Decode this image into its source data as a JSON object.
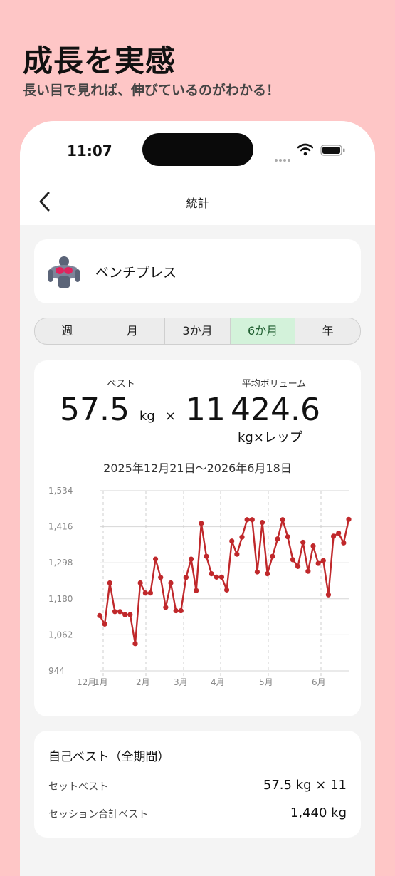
{
  "promo": {
    "headline": "成長を実感",
    "subline": "長い目で見れば、伸びているのがわかる！"
  },
  "status_bar": {
    "time": "11:07",
    "icons": [
      "signal-dots-icon",
      "wifi-icon",
      "battery-icon"
    ]
  },
  "nav": {
    "back_icon": "chevron-left-icon",
    "title": "統計"
  },
  "exercise": {
    "icon": "muscle-torso-icon",
    "name": "ベンチプレス"
  },
  "periods": {
    "items": [
      "週",
      "月",
      "3か月",
      "6か月",
      "年"
    ],
    "selected": "6か月"
  },
  "stats": {
    "best_label": "ベスト",
    "best_weight": "57.5",
    "best_unit": "kg",
    "best_times": "×",
    "best_reps": "11",
    "avg_label": "平均ボリューム",
    "avg_value": "424.6",
    "avg_unit": "kg×レップ",
    "date_range": "2025年12月21日〜2026年6月18日"
  },
  "chart_data": {
    "type": "line",
    "ylim": [
      944,
      1534
    ],
    "y_ticks": [
      "1,534",
      "1,416",
      "1,298",
      "1,180",
      "1,062",
      "944"
    ],
    "x_ticks": [
      "12月",
      "1月",
      "2月",
      "3月",
      "4月",
      "5月",
      "6月"
    ],
    "grid": true,
    "series_color": "#c0282b",
    "values": [
      1125,
      1097,
      1232,
      1138,
      1138,
      1128,
      1128,
      1033,
      1232,
      1199,
      1199,
      1310,
      1250,
      1152,
      1232,
      1141,
      1141,
      1250,
      1310,
      1207,
      1427,
      1319,
      1262,
      1251,
      1251,
      1209,
      1369,
      1326,
      1382,
      1439,
      1439,
      1268,
      1430,
      1262,
      1319,
      1376,
      1439,
      1383,
      1308,
      1286,
      1365,
      1270,
      1353,
      1296,
      1305,
      1193,
      1385,
      1395,
      1363,
      1440
    ]
  },
  "records": {
    "title": "自己ベスト（全期間）",
    "rows": [
      {
        "label": "セットベスト",
        "value": "57.5 kg × 11"
      },
      {
        "label": "セッション合計ベスト",
        "value": "1,440 kg"
      }
    ]
  }
}
